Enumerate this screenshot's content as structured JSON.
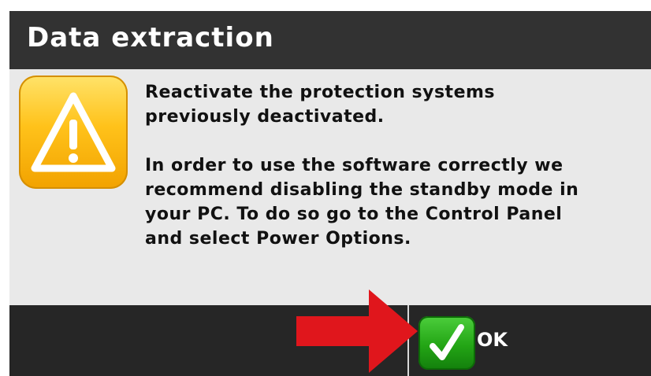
{
  "dialog": {
    "title": "Data extraction",
    "message_line1": "Reactivate the protection systems previously deactivated.",
    "message_line2": "In order to use the software correctly we recommend disabling the standby mode in your PC. To do so go to the Control Panel and select Power Options.",
    "ok_label": "OK"
  },
  "icons": {
    "warning": "warning-triangle-icon",
    "ok": "checkmark-icon",
    "annotation": "red-arrow-icon"
  },
  "colors": {
    "titlebar": "#323232",
    "body": "#e9e9e9",
    "footer": "#262626",
    "warning": "#ffc21a",
    "ok_green": "#23a515",
    "arrow_red": "#e0161c"
  }
}
